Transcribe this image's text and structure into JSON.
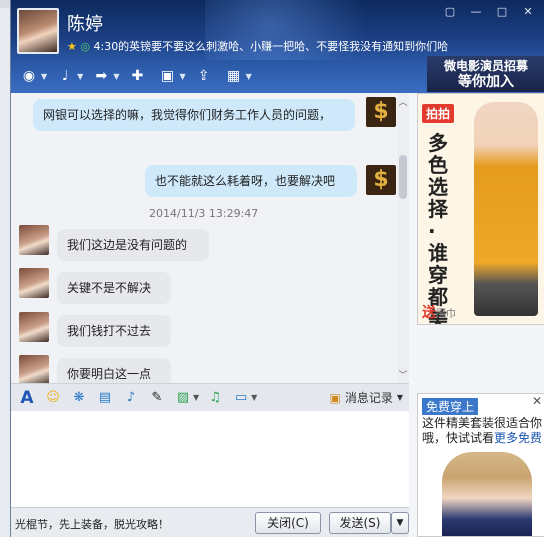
{
  "contact": {
    "name": "陈婷",
    "status": "4:30的英镑要不要这么刺激哈、小赚一把哈、不要怪我没有通知到你们哈"
  },
  "window_buttons": [
    "▢",
    "—",
    "□",
    "✕"
  ],
  "ad_banner": {
    "line1": "微电影演员招募",
    "line2": "等你加入"
  },
  "chat": {
    "timestamp": "2014/11/3 13:29:47",
    "messages": [
      {
        "from": "me",
        "text": "网银可以选择的嘛，我觉得你们财务工作人员的问题，"
      },
      {
        "from": "me",
        "text": "也不能就这么耗着呀，也要解决吧"
      },
      {
        "from": "other",
        "text": "我们这边是没有问题的"
      },
      {
        "from": "other",
        "text": "关键不是不解决"
      },
      {
        "from": "other",
        "text": "我们钱打不过去"
      },
      {
        "from": "other",
        "text": "你要明白这一点"
      }
    ]
  },
  "side_ad": {
    "tag": "拍拍",
    "headline": "多色选择·谁穿都美",
    "footer": "送",
    "footer_small": "围巾"
  },
  "format_toolbar": {
    "history_label": "消息记录"
  },
  "bottom": {
    "promo": "光棍节，先上装备，脱光攻略！",
    "close_label": "关闭(C)",
    "send_label": "发送(S)"
  },
  "side_ad2": {
    "head": "免费穿上",
    "text": "这件精美套装很适合你哦，快试试看",
    "link": "更多免费"
  }
}
